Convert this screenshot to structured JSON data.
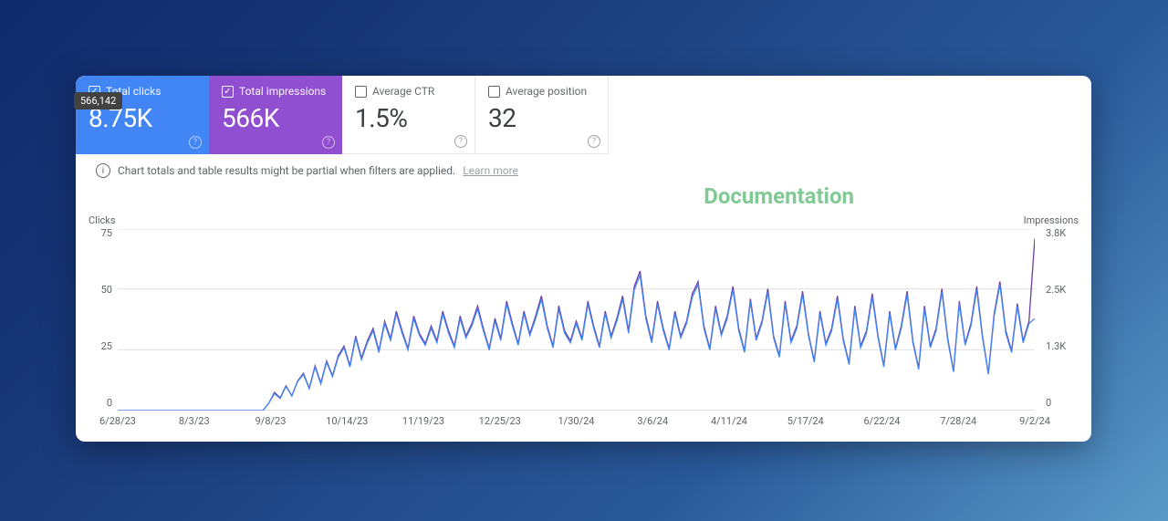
{
  "tooltip": {
    "value": "566,142"
  },
  "metrics": [
    {
      "label": "Total clicks",
      "value": "8.75K",
      "checked": true
    },
    {
      "label": "Total impressions",
      "value": "566K",
      "checked": true
    },
    {
      "label": "Average CTR",
      "value": "1.5%",
      "checked": false
    },
    {
      "label": "Average position",
      "value": "32",
      "checked": false
    }
  ],
  "info": {
    "text": "Chart totals and table results might be partial when filters are applied.",
    "link": "Learn more"
  },
  "watermark": "Documentation",
  "axes": {
    "left_label": "Clicks",
    "right_label": "Impressions",
    "left_ticks": [
      "75",
      "50",
      "25",
      "0"
    ],
    "right_ticks": [
      "3.8K",
      "2.5K",
      "1.3K",
      "0"
    ],
    "x_ticks": [
      "6/28/23",
      "8/3/23",
      "9/8/23",
      "10/14/23",
      "11/19/23",
      "12/25/23",
      "1/30/24",
      "3/6/24",
      "4/11/24",
      "5/17/24",
      "6/22/24",
      "7/28/24",
      "9/2/24"
    ]
  },
  "chart_data": {
    "type": "line",
    "title": "",
    "xlabel": "",
    "ylabel_left": "Clicks",
    "ylabel_right": "Impressions",
    "ylim_left": [
      0,
      75
    ],
    "ylim_right": [
      0,
      3800
    ],
    "x_categories": [
      "6/28/23",
      "8/3/23",
      "9/8/23",
      "10/14/23",
      "11/19/23",
      "12/25/23",
      "1/30/24",
      "3/6/24",
      "4/11/24",
      "5/17/24",
      "6/22/24",
      "7/28/24",
      "9/2/24"
    ],
    "series": [
      {
        "name": "Clicks",
        "axis": "left",
        "color": "#4285f4",
        "values": [
          0,
          0,
          0,
          0,
          0,
          0,
          0,
          0,
          0,
          0,
          0,
          0,
          0,
          0,
          0,
          0,
          0,
          0,
          0,
          0,
          0,
          0,
          0,
          0,
          0,
          0,
          3,
          7,
          5,
          10,
          6,
          12,
          15,
          9,
          18,
          11,
          20,
          14,
          22,
          26,
          18,
          30,
          21,
          28,
          33,
          24,
          36,
          29,
          40,
          32,
          25,
          38,
          31,
          27,
          34,
          28,
          40,
          32,
          26,
          38,
          30,
          35,
          42,
          33,
          25,
          37,
          29,
          44,
          35,
          27,
          40,
          31,
          38,
          46,
          34,
          26,
          42,
          32,
          28,
          36,
          29,
          44,
          34,
          26,
          40,
          30,
          37,
          46,
          32,
          50,
          56,
          38,
          28,
          44,
          33,
          25,
          40,
          30,
          36,
          47,
          52,
          34,
          25,
          42,
          31,
          38,
          50,
          33,
          24,
          45,
          29,
          36,
          49,
          30,
          22,
          44,
          28,
          34,
          48,
          31,
          20,
          40,
          27,
          33,
          46,
          29,
          19,
          42,
          26,
          32,
          47,
          30,
          18,
          40,
          25,
          34,
          48,
          28,
          17,
          42,
          26,
          33,
          49,
          29,
          16,
          44,
          27,
          35,
          50,
          30,
          15,
          39,
          52,
          32,
          24,
          43,
          28,
          36,
          38
        ]
      },
      {
        "name": "Impressions",
        "axis": "right",
        "color": "#6b3fa0",
        "values": [
          0,
          0,
          0,
          0,
          0,
          0,
          0,
          0,
          0,
          0,
          0,
          0,
          0,
          0,
          0,
          0,
          0,
          0,
          0,
          0,
          0,
          0,
          0,
          0,
          0,
          0,
          150,
          380,
          270,
          520,
          310,
          620,
          780,
          470,
          940,
          580,
          1040,
          730,
          1150,
          1350,
          940,
          1560,
          1100,
          1460,
          1720,
          1250,
          1870,
          1510,
          2080,
          1670,
          1300,
          1980,
          1610,
          1400,
          1770,
          1460,
          2080,
          1670,
          1350,
          1980,
          1560,
          1820,
          2190,
          1720,
          1300,
          1930,
          1510,
          2290,
          1820,
          1400,
          2080,
          1610,
          1980,
          2400,
          1770,
          1350,
          2190,
          1670,
          1460,
          1870,
          1510,
          2290,
          1770,
          1350,
          2080,
          1560,
          1930,
          2400,
          1670,
          2600,
          2920,
          1980,
          1460,
          2290,
          1720,
          1300,
          2080,
          1560,
          1870,
          2450,
          2700,
          1770,
          1300,
          2190,
          1610,
          1980,
          2600,
          1720,
          1250,
          2340,
          1510,
          1870,
          2550,
          1560,
          1150,
          2290,
          1460,
          1770,
          2500,
          1610,
          1040,
          2080,
          1400,
          1720,
          2400,
          1510,
          990,
          2190,
          1350,
          1670,
          2450,
          1560,
          940,
          2080,
          1300,
          1770,
          2500,
          1460,
          890,
          2190,
          1350,
          1720,
          2550,
          1510,
          830,
          2290,
          1400,
          1820,
          2600,
          1560,
          780,
          2030,
          2700,
          1670,
          1250,
          2240,
          1460,
          1870,
          3600
        ]
      }
    ]
  }
}
